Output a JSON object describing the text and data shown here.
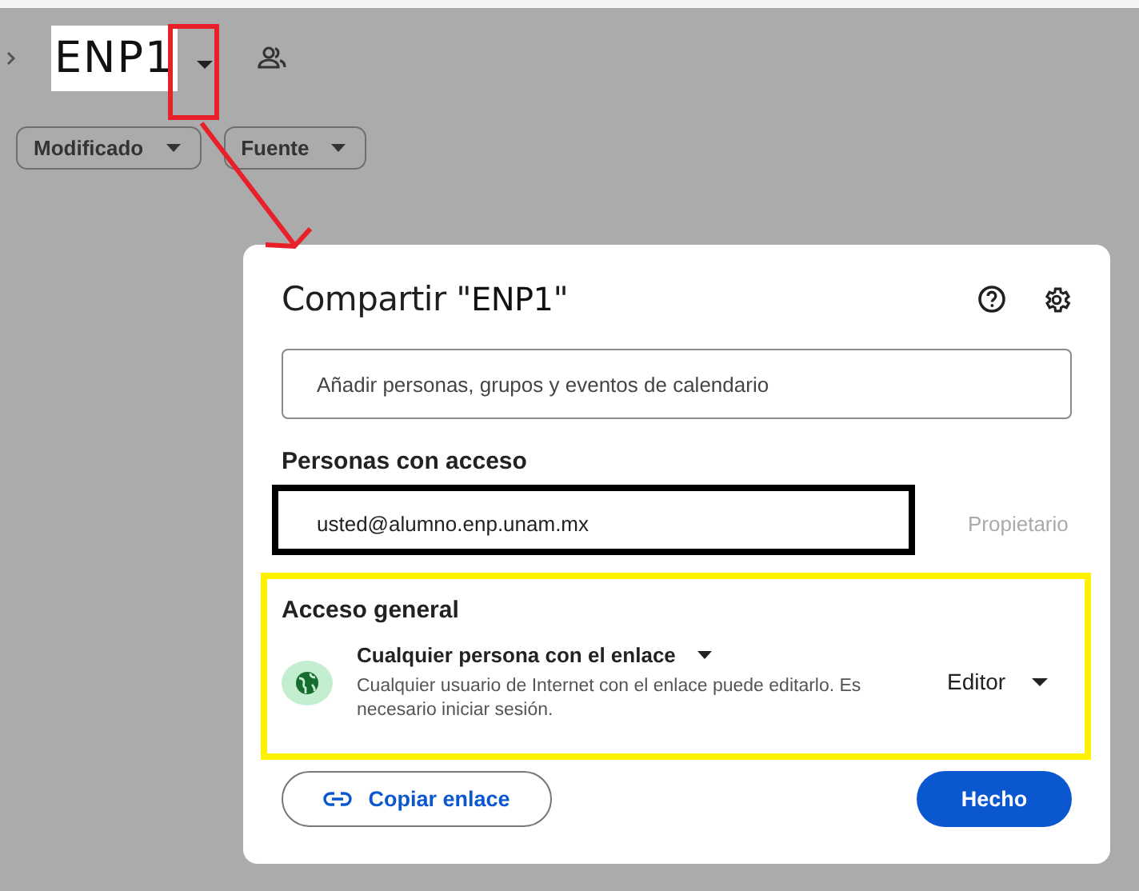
{
  "breadcrumb": {
    "title": "ENP1"
  },
  "filters": [
    {
      "label": "Modificado"
    },
    {
      "label": "Fuente"
    }
  ],
  "dialog": {
    "title_prefix": "Compartir \"",
    "title_name": "ENP1",
    "title_suffix": "\"",
    "search": {
      "placeholder": "Añadir personas, grupos y eventos de calendario"
    },
    "people_heading": "Personas con acceso",
    "people": [
      {
        "email": "usted@alumno.enp.unam.mx",
        "role": "Propietario"
      }
    ],
    "general_heading": "Acceso general",
    "access": {
      "scope": "Cualquier persona con el enlace",
      "description": "Cualquier usuario de Internet con el enlace puede editarlo. Es necesario iniciar sesión.",
      "role": "Editor"
    },
    "buttons": {
      "copy": "Copiar enlace",
      "done": "Hecho"
    }
  }
}
